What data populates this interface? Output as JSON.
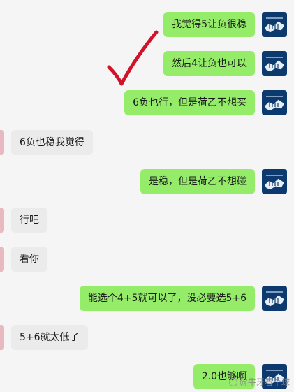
{
  "messages": [
    {
      "side": "out",
      "text": "我觉得5让负很稳"
    },
    {
      "side": "out",
      "text": "然后4让负也可以"
    },
    {
      "side": "out",
      "text": "6负也行，但是荷乙不想买"
    },
    {
      "side": "in",
      "text": "6负也稳我觉得"
    },
    {
      "side": "out",
      "text": "是稳，但是荷乙不想碰"
    },
    {
      "side": "in",
      "text": "行吧"
    },
    {
      "side": "in",
      "text": "看你"
    },
    {
      "side": "out",
      "text": "能选个4+5就可以了，没必要选5+6"
    },
    {
      "side": "in",
      "text": "5+6就太低了"
    },
    {
      "side": "out",
      "text": "2.0也够啊"
    }
  ],
  "watermark": {
    "text": "@牛牙看个球"
  },
  "colors": {
    "outgoing_bubble": "#95ec69",
    "incoming_bubble": "#ebebeb",
    "background": "#f5f5f5",
    "checkmark": "#d0122a",
    "avatar": "#0d3a6e"
  },
  "icons": {
    "avatar": "team-crest-avatar-icon",
    "annotation": "red-checkmark-icon",
    "watermark": "weibo-logo-icon"
  }
}
